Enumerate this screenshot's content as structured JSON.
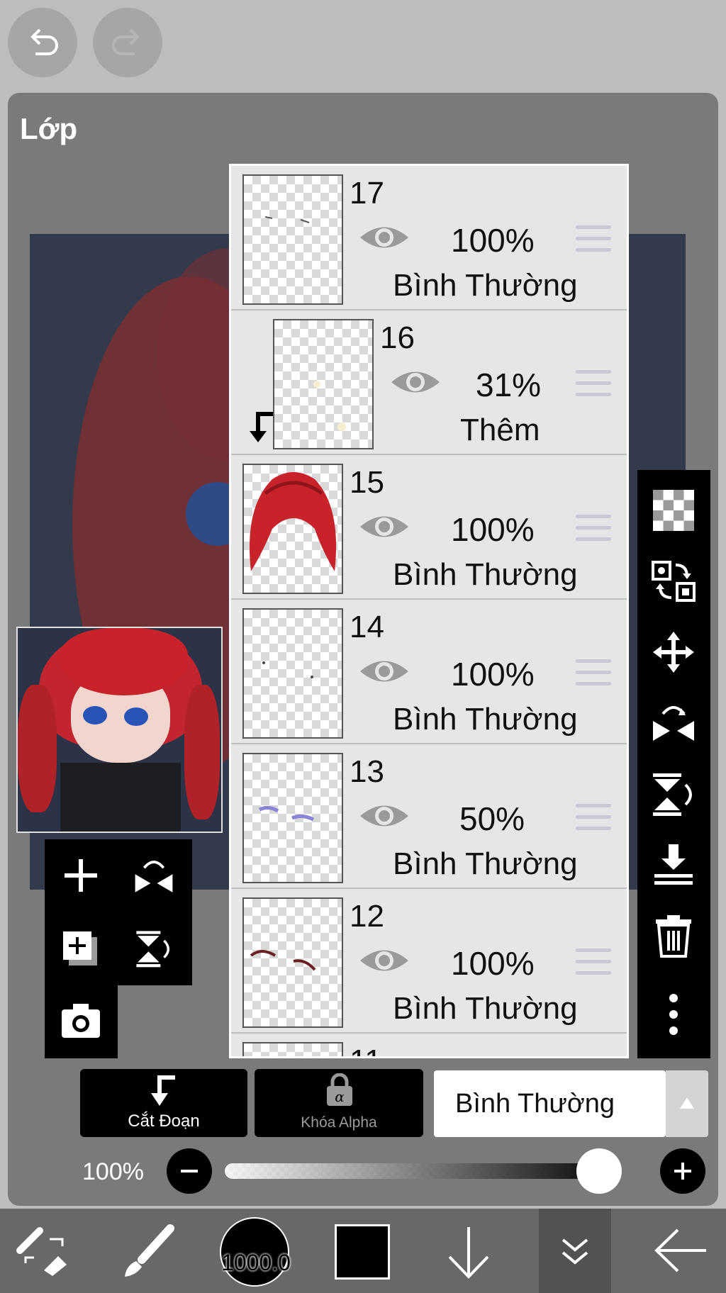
{
  "header": {
    "undo_icon": "undo-icon",
    "redo_icon": "redo-icon"
  },
  "panel": {
    "title": "Lớp"
  },
  "layers": [
    {
      "number": "17",
      "opacity": "100%",
      "blend": "Bình Thường",
      "thumb": "sketch-dots"
    },
    {
      "number": "16",
      "opacity": "31%",
      "blend": "Thêm",
      "thumb": "light-spots",
      "clipped": true
    },
    {
      "number": "15",
      "opacity": "100%",
      "blend": "Bình Thường",
      "thumb": "red-hair"
    },
    {
      "number": "14",
      "opacity": "100%",
      "blend": "Bình Thường",
      "thumb": "dots"
    },
    {
      "number": "13",
      "opacity": "50%",
      "blend": "Bình Thường",
      "thumb": "purple-strokes"
    },
    {
      "number": "12",
      "opacity": "100%",
      "blend": "Bình Thường",
      "thumb": "eyebrows"
    }
  ],
  "layer_partial_number": "11",
  "controls": {
    "clip_label": "Cắt Đoạn",
    "alpha_lock_label": "Khóa Alpha",
    "blend_mode": "Bình Thường",
    "opacity_label": "100%",
    "opacity_value": 1.0
  },
  "bottom_bar": {
    "brush_size": "1000.0",
    "color": "#000000"
  },
  "colors": {
    "panel": "#7a7a7a",
    "hair": "#c8232b",
    "accent": "#000000"
  }
}
